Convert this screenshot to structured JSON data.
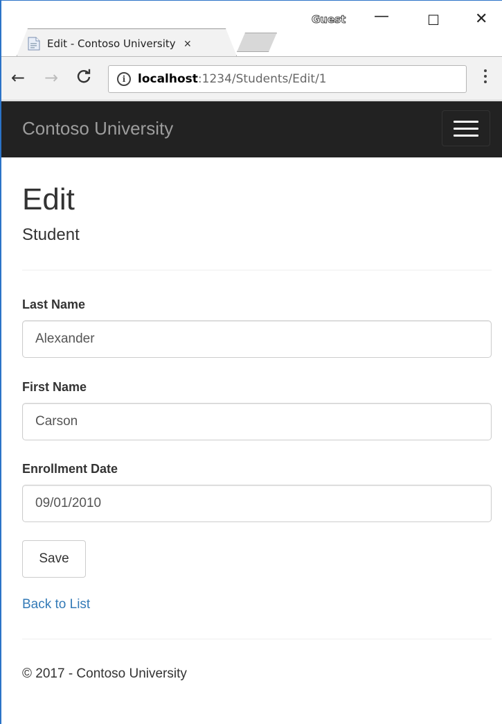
{
  "browser": {
    "tab_title": "Edit - Contoso University",
    "tab_close": "×",
    "profile": "Guest",
    "controls": {
      "minimize": "—",
      "maximize": "☐",
      "close": "✕"
    },
    "nav": {
      "back": "←",
      "forward": "→",
      "reload": "C"
    },
    "info_icon": "i",
    "url_host": "localhost",
    "url_path": ":1234/Students/Edit/1"
  },
  "navbar": {
    "brand": "Contoso University",
    "menu_icon": "hamburger-icon"
  },
  "page": {
    "title": "Edit",
    "subtitle": "Student"
  },
  "form": {
    "last_name_label": "Last Name",
    "last_name_value": "Alexander",
    "first_name_label": "First Name",
    "first_name_value": "Carson",
    "enrollment_date_label": "Enrollment Date",
    "enrollment_date_value": "09/01/2010",
    "save_label": "Save"
  },
  "links": {
    "back_to_list": "Back to List"
  },
  "footer": {
    "text": "© 2017 - Contoso University"
  },
  "colors": {
    "navbar_bg": "#222222",
    "brand_text": "#9d9d9d",
    "link": "#337ab7",
    "window_border": "#2b73c7"
  }
}
